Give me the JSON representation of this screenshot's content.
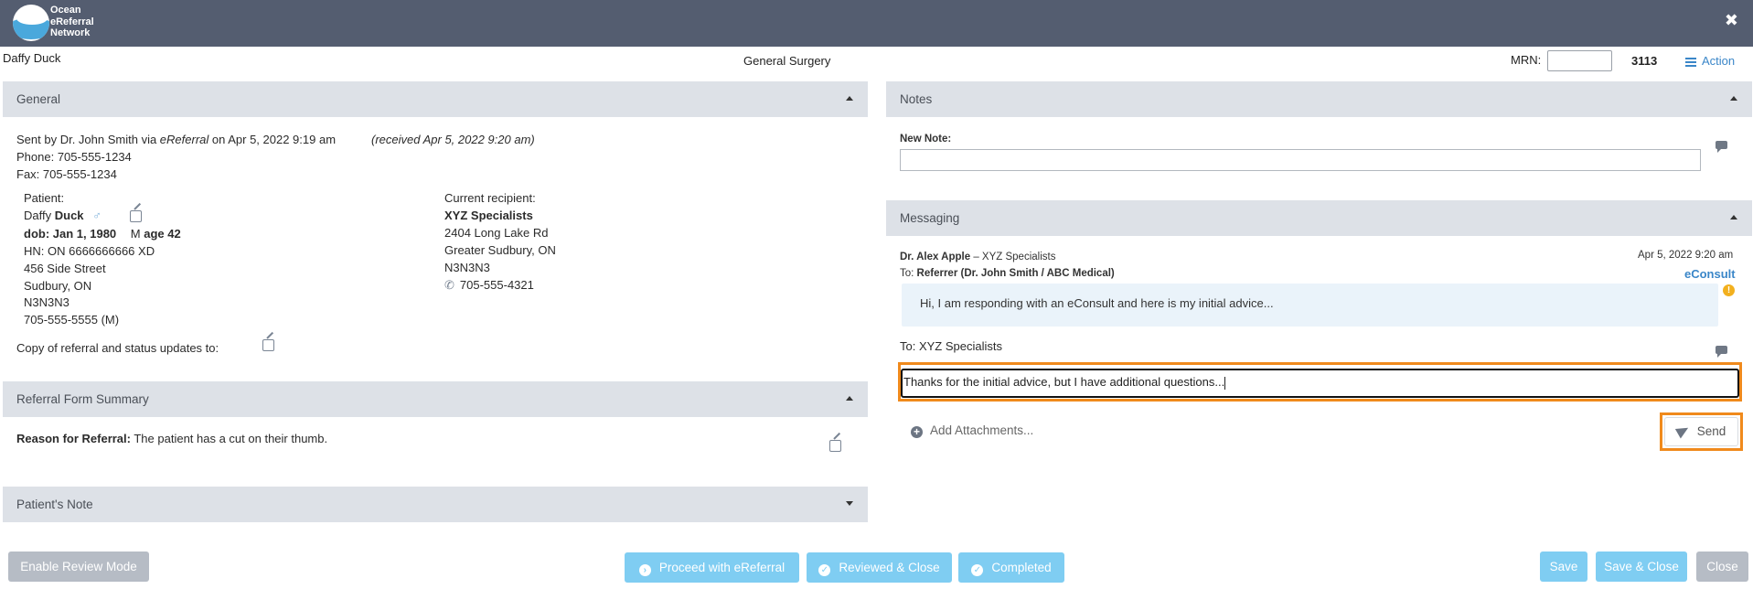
{
  "app": {
    "logo_lines": [
      "Ocean",
      "eReferral",
      "Network"
    ],
    "close_symbol": "✖",
    "accent_color": "#3a86c8",
    "header_color": "#545d70"
  },
  "header": {
    "patient_name": "Daffy Duck",
    "referral_type": "General Surgery",
    "mrn_label": "MRN:",
    "mrn_value": "",
    "ref_number": "3113",
    "action_label": "Action"
  },
  "general": {
    "title": "General",
    "sent_by_prefix": "Sent by Dr. John Smith via ",
    "sent_by_channel": "eReferral",
    "sent_by_date": " on Apr 5, 2022 9:19 am",
    "received": "(received Apr 5, 2022 9:20 am)",
    "phone": "Phone: 705-555-1234",
    "fax": "Fax: 705-555-1234",
    "patient": {
      "label": "Patient:",
      "first_name": "Daffy",
      "last_name": "Duck",
      "gender_symbol": "♂",
      "dob": "dob: Jan 1, 1980",
      "sex": "M",
      "age": "age 42",
      "hn": "HN: ON 6666666666 XD",
      "address1": "456 Side Street",
      "address2": "Sudbury, ON",
      "postal": "N3N3N3",
      "phone": "705-555-5555 (M)"
    },
    "recipient": {
      "label": "Current recipient:",
      "name": "XYZ Specialists",
      "address1": "2404 Long Lake Rd",
      "address2": "Greater Sudbury, ON",
      "postal": "N3N3N3",
      "phone": "705-555-4321"
    },
    "copy_label": "Copy of referral and status updates to:"
  },
  "referral_summary": {
    "title": "Referral Form Summary",
    "reason_label": "Reason for Referral:",
    "reason_text": " The patient has a cut on their thumb."
  },
  "patient_note": {
    "title": "Patient's Note"
  },
  "notes": {
    "title": "Notes",
    "new_note_label": "New Note:",
    "new_note_value": ""
  },
  "messaging": {
    "title": "Messaging",
    "from_name": "Dr. Alex Apple",
    "from_sep": " – ",
    "from_org": "XYZ Specialists",
    "timestamp": "Apr 5, 2022 9:20 am",
    "to_prefix": "To: ",
    "to_value": "Referrer (Dr. John Smith / ABC Medical)",
    "type_label": "eConsult",
    "message_text": "Hi, I am responding with an eConsult and here is my initial advice...",
    "warn_symbol": "!",
    "reply_to": "To: XYZ Specialists",
    "reply_text": "Thanks for the initial advice, but I have additional questions...",
    "add_attachments": "Add Attachments...",
    "send_label": "Send"
  },
  "footer": {
    "enable_review": "Enable Review Mode",
    "proceed": "Proceed with eReferral",
    "reviewed_close": "Reviewed & Close",
    "completed": "Completed",
    "save": "Save",
    "save_close": "Save & Close",
    "close": "Close"
  }
}
